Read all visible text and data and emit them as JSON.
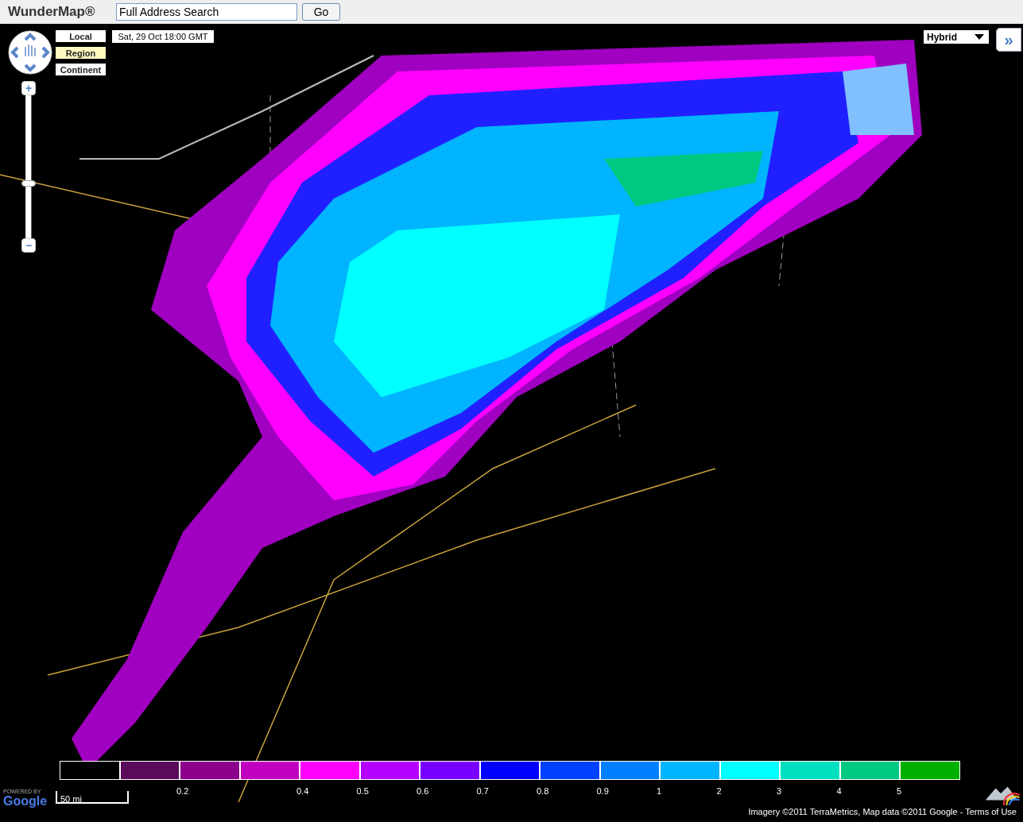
{
  "app": {
    "title": "WunderMap®"
  },
  "search": {
    "value": "Full Address Search",
    "button": "Go"
  },
  "navigation": {
    "zoom_in": "+",
    "zoom_out": "−",
    "level": 0.36
  },
  "views": [
    {
      "label": "Local",
      "selected": false
    },
    {
      "label": "Region",
      "selected": true
    },
    {
      "label": "Continent",
      "selected": false
    }
  ],
  "timestamp": "Sat, 29 Oct 18:00 GMT",
  "map_type": {
    "value": "Hybrid"
  },
  "panel_toggle": "»",
  "legend": [
    {
      "color": "#000000"
    },
    {
      "color": "#5c0a5c"
    },
    {
      "color": "#8c008c",
      "label": "0.2"
    },
    {
      "color": "#c000c0"
    },
    {
      "color": "#ff00ff",
      "label": "0.4"
    },
    {
      "color": "#b400ff",
      "label": "0.5"
    },
    {
      "color": "#7800ff",
      "label": "0.6"
    },
    {
      "color": "#0000ff",
      "label": "0.7"
    },
    {
      "color": "#0040ff",
      "label": "0.8"
    },
    {
      "color": "#0080ff",
      "label": "0.9"
    },
    {
      "color": "#00b4ff",
      "label": "1"
    },
    {
      "color": "#00ffff",
      "label": "2"
    },
    {
      "color": "#00e0c0",
      "label": "3"
    },
    {
      "color": "#00c880",
      "label": "4"
    },
    {
      "color": "#00b000",
      "label": "5"
    }
  ],
  "scale": "50 mi",
  "powered_by": "POWERED BY",
  "google": "Google",
  "attribution": "Imagery ©2011 TerraMetrics, Map data ©2011 Google - Terms of Use"
}
